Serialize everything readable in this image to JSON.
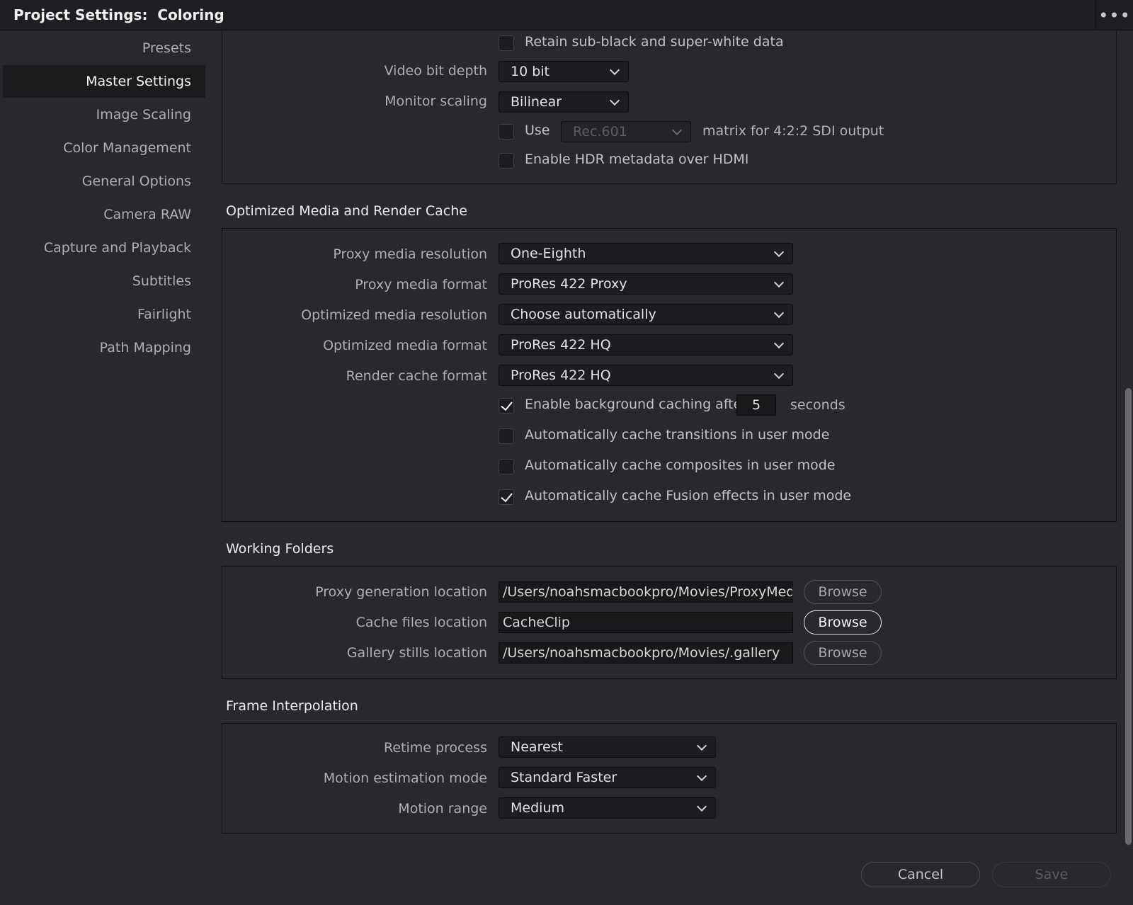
{
  "window": {
    "title": "Project Settings:  Coloring",
    "more_icon": "more-horizontal-icon"
  },
  "sidebar": {
    "items": [
      {
        "label": "Presets",
        "active": false
      },
      {
        "label": "Master Settings",
        "active": true
      },
      {
        "label": "Image Scaling",
        "active": false
      },
      {
        "label": "Color Management",
        "active": false
      },
      {
        "label": "General Options",
        "active": false
      },
      {
        "label": "Camera RAW",
        "active": false
      },
      {
        "label": "Capture and Playback",
        "active": false
      },
      {
        "label": "Subtitles",
        "active": false
      },
      {
        "label": "Fairlight",
        "active": false
      },
      {
        "label": "Path Mapping",
        "active": false
      }
    ]
  },
  "video": {
    "retain_label": "Retain sub-black and super-white data",
    "retain_checked": false,
    "bit_depth_label": "Video bit depth",
    "bit_depth_value": "10 bit",
    "monitor_scaling_label": "Monitor scaling",
    "monitor_scaling_value": "Bilinear",
    "use_label": "Use",
    "use_checked": false,
    "matrix_value": "Rec.601",
    "matrix_suffix": "matrix for 4:2:2 SDI output",
    "hdr_label": "Enable HDR metadata over HDMI",
    "hdr_checked": false
  },
  "cache": {
    "title": "Optimized Media and Render Cache",
    "proxy_res_label": "Proxy media resolution",
    "proxy_res_value": "One-Eighth",
    "proxy_format_label": "Proxy media format",
    "proxy_format_value": "ProRes 422 Proxy",
    "opt_res_label": "Optimized media resolution",
    "opt_res_value": "Choose automatically",
    "opt_format_label": "Optimized media format",
    "opt_format_value": "ProRes 422 HQ",
    "render_format_label": "Render cache format",
    "render_format_value": "ProRes 422 HQ",
    "bg_label": "Enable background caching after",
    "bg_checked": true,
    "bg_seconds": "5",
    "bg_suffix": "seconds",
    "transitions_label": "Automatically cache transitions in user mode",
    "transitions_checked": false,
    "composites_label": "Automatically cache composites in user mode",
    "composites_checked": false,
    "fusion_label": "Automatically cache Fusion effects in user mode",
    "fusion_checked": true
  },
  "folders": {
    "title": "Working Folders",
    "proxy_label": "Proxy generation location",
    "proxy_value": "/Users/noahsmacbookpro/Movies/ProxyMedia",
    "cache_label": "Cache files location",
    "cache_value": "CacheClip",
    "gallery_label": "Gallery stills location",
    "gallery_value": "/Users/noahsmacbookpro/Movies/.gallery",
    "browse_label": "Browse"
  },
  "interp": {
    "title": "Frame Interpolation",
    "retime_label": "Retime process",
    "retime_value": "Nearest",
    "motion_mode_label": "Motion estimation mode",
    "motion_mode_value": "Standard Faster",
    "motion_range_label": "Motion range",
    "motion_range_value": "Medium"
  },
  "footer": {
    "cancel_label": "Cancel",
    "save_label": "Save"
  }
}
